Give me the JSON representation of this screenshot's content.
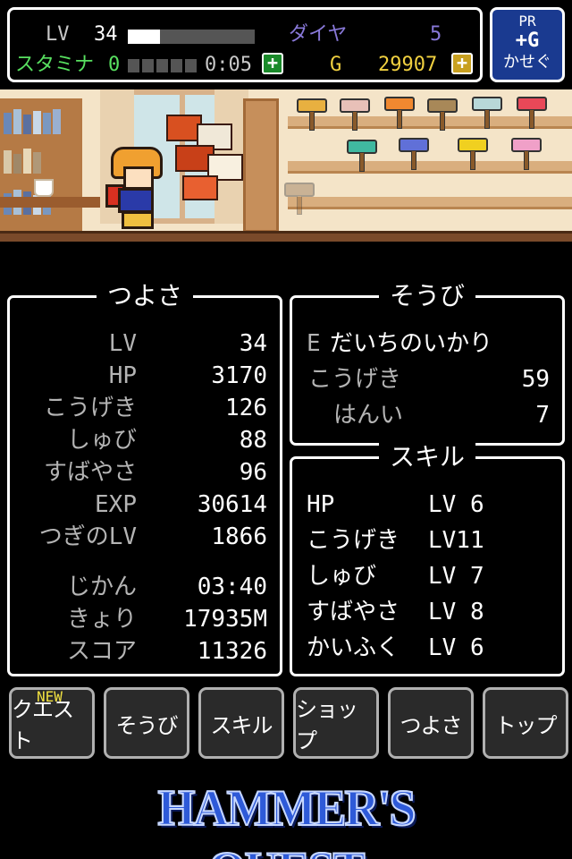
{
  "status": {
    "lv_label": "LV",
    "lv_value": "34",
    "lv_progress": 0.25,
    "stamina_label": "スタミナ",
    "stamina_value": "0",
    "stamina_timer": "0:05",
    "diamond_label": "ダイヤ",
    "diamond_value": "5",
    "gold_label": "G",
    "gold_value": "29907",
    "plus_symbol": "+"
  },
  "pr_button": {
    "pr": "PR",
    "gain": "+G",
    "earn": "かせぐ"
  },
  "strength_panel": {
    "title": "つよさ",
    "rows": [
      {
        "label": "LV",
        "value": "34"
      },
      {
        "label": "HP",
        "value": "3170"
      },
      {
        "label": "こうげき",
        "value": "126"
      },
      {
        "label": "しゅび",
        "value": "88"
      },
      {
        "label": "すばやさ",
        "value": "96"
      },
      {
        "label": "EXP",
        "value": "30614"
      },
      {
        "label": "つぎのLV",
        "value": "1866"
      },
      {
        "label": "じかん",
        "value": "03:40"
      },
      {
        "label": "きょり",
        "value": "17935M"
      },
      {
        "label": "スコア",
        "value": "11326"
      }
    ]
  },
  "equip_panel": {
    "title": "そうび",
    "equipped_marker": "E",
    "weapon_name": "だいちのいかり",
    "attack_label": "こうげき",
    "attack_value": "59",
    "range_label": "はんい",
    "range_value": "7"
  },
  "skill_panel": {
    "title": "スキル",
    "skills": [
      {
        "name": "HP",
        "level": "LV 6"
      },
      {
        "name": "こうげき",
        "level": "LV11"
      },
      {
        "name": "しゅび",
        "level": "LV 7"
      },
      {
        "name": "すばやさ",
        "level": "LV 8"
      },
      {
        "name": "かいふく",
        "level": "LV 6"
      }
    ]
  },
  "menu": {
    "new_badge": "NEW",
    "items": [
      {
        "label": "クエスト"
      },
      {
        "label": "そうび"
      },
      {
        "label": "スキル"
      },
      {
        "label": "ショップ"
      },
      {
        "label": "つよさ"
      },
      {
        "label": "トップ"
      }
    ]
  },
  "logo": {
    "text": "HAMMER'S QUEST"
  },
  "colors": {
    "accent_green": "#58e060",
    "gold_yellow": "#f0d040",
    "diamond_purple": "#8878d8",
    "pr_blue": "#1a3a90",
    "logo_blue": "#2e5ad8"
  },
  "icons": [
    "plus-icon",
    "hero-sprite",
    "hammer-icon"
  ]
}
